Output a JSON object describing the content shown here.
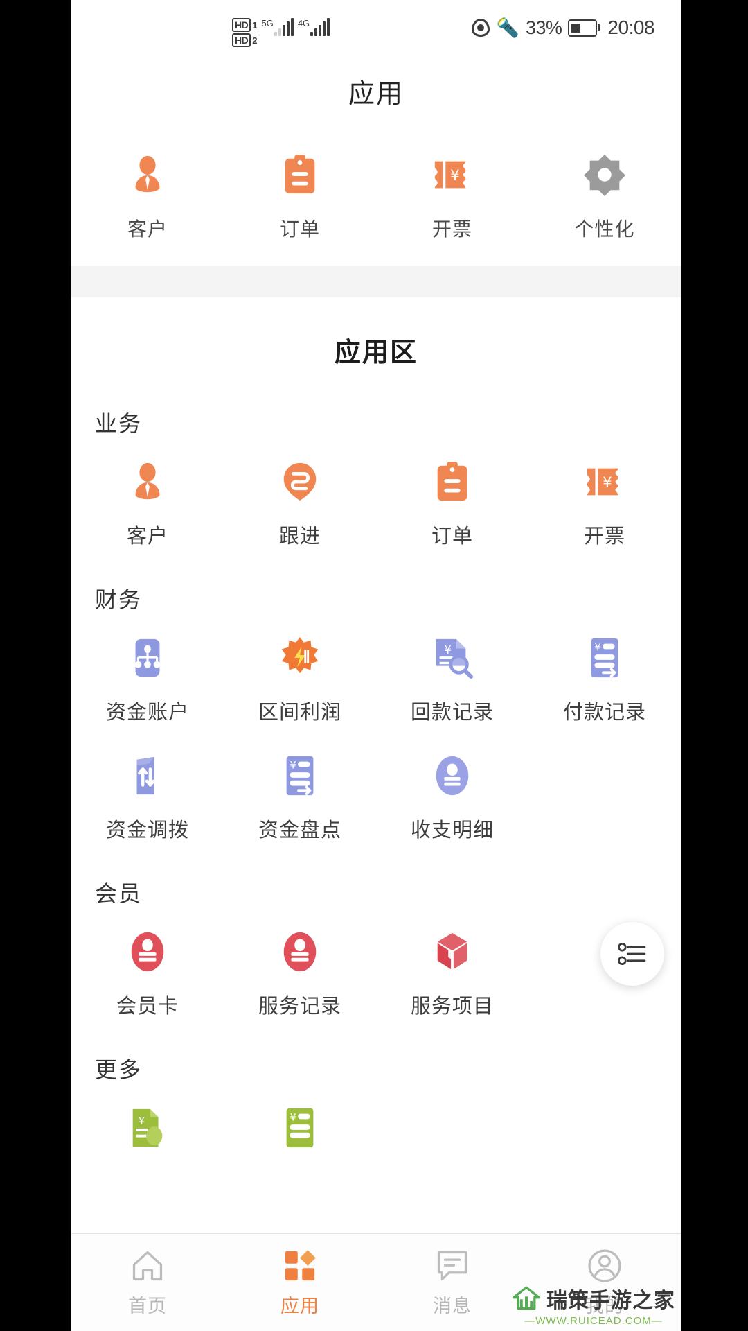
{
  "status_bar": {
    "hd_label": "HD",
    "sim1": "1",
    "sim2": "2",
    "net1": "5G",
    "net2": "4G",
    "eye_icon": "eye-comfort-icon",
    "bluetooth_icon": "bluetooth-icon",
    "battery_percent": "33%",
    "battery_icon": "battery-icon",
    "time": "20:08"
  },
  "header": {
    "title": "应用"
  },
  "quick_apps": [
    {
      "label": "客户",
      "icon": "customer-icon",
      "color": "#f08652"
    },
    {
      "label": "订单",
      "icon": "order-clipboard-icon",
      "color": "#f08652"
    },
    {
      "label": "开票",
      "icon": "invoice-ticket-icon",
      "color": "#f08652"
    },
    {
      "label": "个性化",
      "icon": "gear-icon",
      "color": "#9b9b9b"
    }
  ],
  "zone": {
    "title": "应用区",
    "groups": [
      {
        "title": "业务",
        "items": [
          {
            "label": "客户",
            "icon": "customer-icon",
            "color": "#f08652"
          },
          {
            "label": "跟进",
            "icon": "follow-up-icon",
            "color": "#f08652"
          },
          {
            "label": "订单",
            "icon": "order-clipboard-icon",
            "color": "#f08652"
          },
          {
            "label": "开票",
            "icon": "invoice-ticket-icon",
            "color": "#f08652"
          }
        ]
      },
      {
        "title": "财务",
        "items": [
          {
            "label": "资金账户",
            "icon": "fund-account-icon",
            "color": "#8f99e0"
          },
          {
            "label": "区间利润",
            "icon": "interval-profit-icon",
            "color": "#f07a35"
          },
          {
            "label": "回款记录",
            "icon": "receipt-record-search-icon",
            "color": "#8f99e0"
          },
          {
            "label": "付款记录",
            "icon": "payment-record-icon",
            "color": "#8f99e0"
          },
          {
            "label": "资金调拨",
            "icon": "fund-transfer-icon",
            "color": "#8f99e0"
          },
          {
            "label": "资金盘点",
            "icon": "fund-check-icon",
            "color": "#8f99e0"
          },
          {
            "label": "收支明细",
            "icon": "income-expense-icon",
            "color": "#9aa2e5"
          }
        ]
      },
      {
        "title": "会员",
        "items": [
          {
            "label": "会员卡",
            "icon": "member-card-icon",
            "color": "#e0505a"
          },
          {
            "label": "服务记录",
            "icon": "service-record-icon",
            "color": "#e0505a"
          },
          {
            "label": "服务项目",
            "icon": "service-item-box-icon",
            "color": "#e0616a"
          }
        ]
      },
      {
        "title": "更多",
        "items": [
          {
            "label": "",
            "icon": "green-invoice-icon",
            "color": "#9dbd3d"
          },
          {
            "label": "",
            "icon": "green-payment-icon",
            "color": "#9dbd3d"
          }
        ]
      }
    ]
  },
  "fab": {
    "icon": "list-settings-icon"
  },
  "tabbar": {
    "items": [
      {
        "label": "首页",
        "icon": "home-icon",
        "active": false
      },
      {
        "label": "应用",
        "icon": "apps-grid-icon",
        "active": true
      },
      {
        "label": "消息",
        "icon": "message-icon",
        "active": false
      },
      {
        "label": "我的",
        "icon": "profile-icon",
        "active": false
      }
    ]
  },
  "watermark": {
    "name": "瑞策手游之家",
    "url": "—WWW.RUICEAD.COM—"
  },
  "colors": {
    "accent_orange": "#f08652",
    "purple": "#8f99e0",
    "red": "#e0505a",
    "green": "#9dbd3d",
    "gray": "#9b9b9b"
  }
}
